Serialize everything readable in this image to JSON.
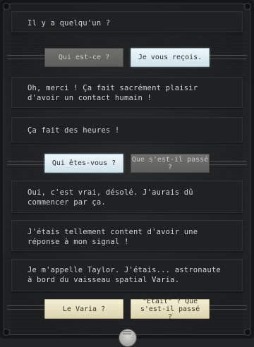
{
  "messages": [
    {
      "text": "Il y a quelqu'un ?"
    },
    {
      "text": "Oh, merci ! Ça fait sacrément plaisir d'avoir un contact humain !"
    },
    {
      "text": "Ça fait des heures !"
    },
    {
      "text": "Oui, c'est vrai, désolé. J'aurais dû commencer par ça."
    },
    {
      "text": "J'étais tellement content d'avoir une réponse à mon signal !"
    },
    {
      "text": "Je m'appelle Taylor. J'étais... astronaute à bord du vaisseau spatial Varia."
    }
  ],
  "choices": [
    {
      "left": "Qui est-ce ?",
      "right": "Je vous reçois."
    },
    {
      "left": "Qui êtes-vous ?",
      "right": "Que s'est-il passé ?"
    },
    {
      "left": "Le Varia ?",
      "right": "\"Était\" ? Que s'est-il passé ?"
    }
  ],
  "colors": {
    "background": "#232526",
    "bubble": "#1f2122",
    "selected_choice": "#dcebf0",
    "unselected_choice": "#676765",
    "pending_choice": "#ebe5c5"
  },
  "icons": {
    "bottom_handle": "menu-knob-icon"
  }
}
